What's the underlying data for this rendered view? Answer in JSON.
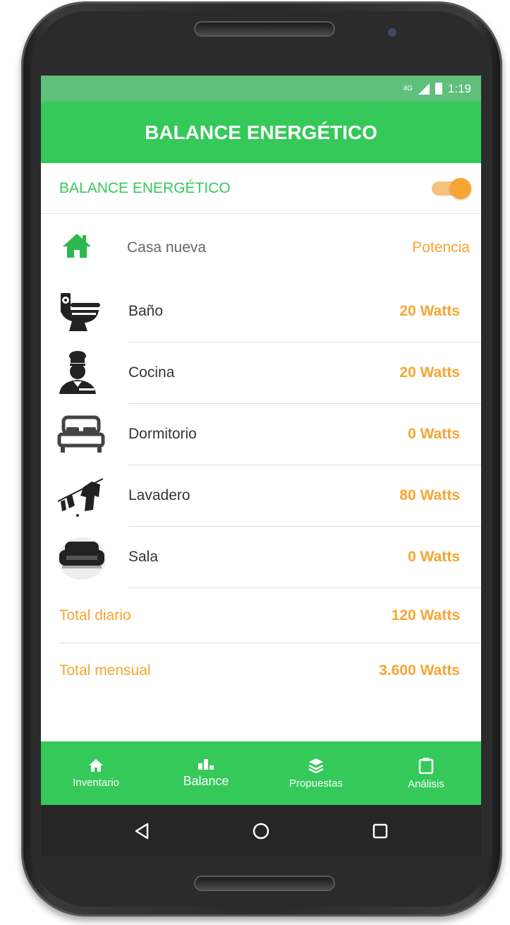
{
  "status_bar": {
    "network": "4G",
    "time": "1:19"
  },
  "app_bar": {
    "title": "BALANCE ENERGÉTICO"
  },
  "toggle": {
    "label": "BALANCE ENERGÉTICO",
    "enabled": true
  },
  "house": {
    "label": "Casa nueva",
    "value": "Potencia",
    "icon": "house-icon"
  },
  "rooms": [
    {
      "name": "Baño",
      "value": "20 Watts",
      "icon": "toilet-icon"
    },
    {
      "name": "Cocina",
      "value": "20 Watts",
      "icon": "chef-icon"
    },
    {
      "name": "Dormitorio",
      "value": "0 Watts",
      "icon": "bed-icon"
    },
    {
      "name": "Lavadero",
      "value": "80 Watts",
      "icon": "clothesline-icon"
    },
    {
      "name": "Sala",
      "value": "0 Watts",
      "icon": "sofa-icon"
    }
  ],
  "totals": {
    "daily_label": "Total diario",
    "daily_value": "120 Watts",
    "monthly_label": "Total mensual",
    "monthly_value": "3.600 Watts"
  },
  "bottom_nav": [
    {
      "label": "Inventario",
      "icon": "home-icon"
    },
    {
      "label": "Balance",
      "icon": "bar-chart-icon",
      "active": true
    },
    {
      "label": "Propuestas",
      "icon": "layers-icon"
    },
    {
      "label": "Análisis",
      "icon": "clipboard-icon"
    }
  ],
  "colors": {
    "green": "#35c95a",
    "orange": "#f7a532",
    "status_green": "#5ec07a"
  }
}
